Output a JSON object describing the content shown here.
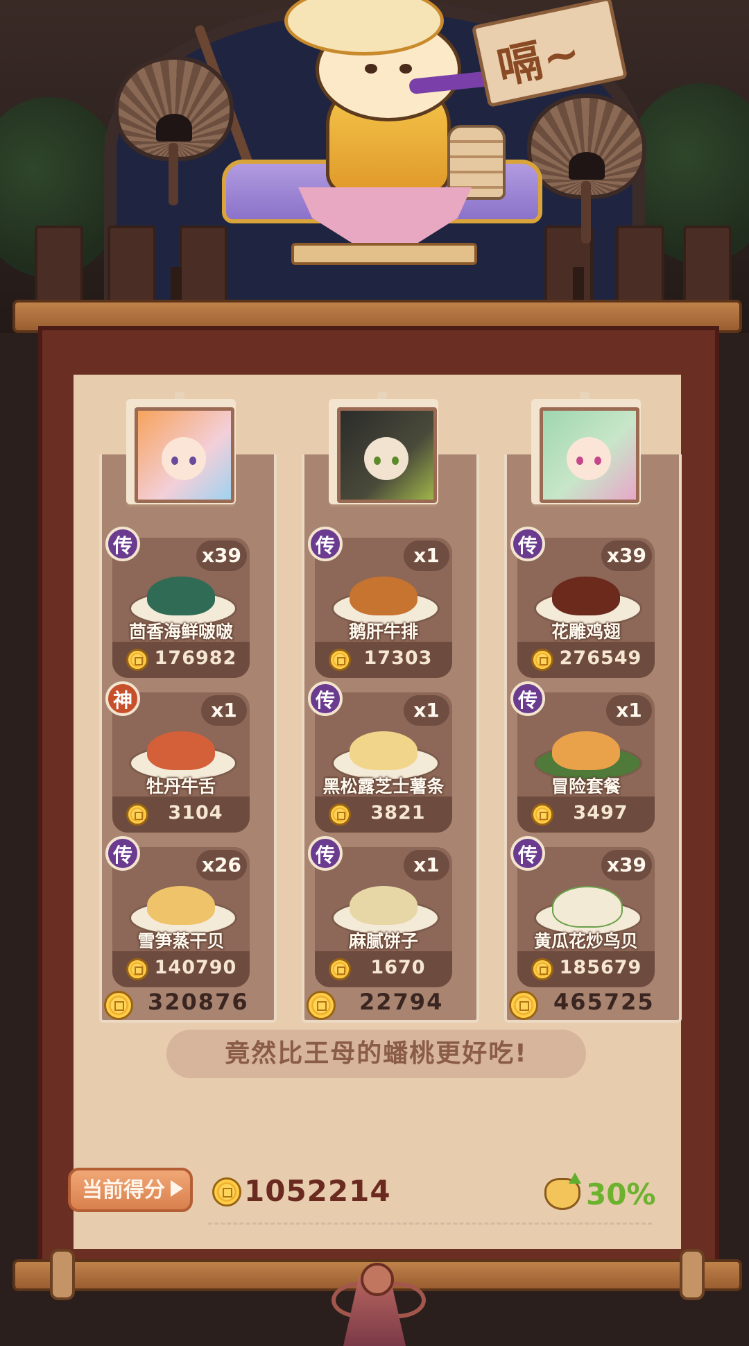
{
  "scene": {
    "sign_text": "嗝~"
  },
  "columns": [
    {
      "portrait": "character-pink-hair-icon",
      "total": "320876",
      "dishes": [
        {
          "badge": "传",
          "qty": "x39",
          "name": "茴香海鲜啵啵",
          "value": "176982",
          "food_color": "#2f6b55"
        },
        {
          "badge": "神",
          "qty": "x1",
          "name": "牡丹牛舌",
          "value": "3104",
          "food_color": "#d4603a"
        },
        {
          "badge": "传",
          "qty": "x26",
          "name": "雪笋蒸干贝",
          "value": "140790",
          "food_color": "#eec36a"
        }
      ]
    },
    {
      "portrait": "character-cat-witch-icon",
      "total": "22794",
      "dishes": [
        {
          "badge": "传",
          "qty": "x1",
          "name": "鹅肝牛排",
          "value": "17303",
          "food_color": "#c6742f"
        },
        {
          "badge": "传",
          "qty": "x1",
          "name": "黑松露芝士薯条",
          "value": "3821",
          "food_color": "#f1d58a"
        },
        {
          "badge": "传",
          "qty": "x1",
          "name": "麻腻饼子",
          "value": "1670",
          "food_color": "#e8d7a6"
        }
      ]
    },
    {
      "portrait": "character-green-hair-icon",
      "total": "465725",
      "dishes": [
        {
          "badge": "传",
          "qty": "x39",
          "name": "花雕鸡翅",
          "value": "276549",
          "food_color": "#6b2a1c"
        },
        {
          "badge": "传",
          "qty": "x1",
          "name": "冒险套餐",
          "value": "3497",
          "food_color": "#e9a14a"
        },
        {
          "badge": "传",
          "qty": "x39",
          "name": "黄瓜花炒鸟贝",
          "value": "185679",
          "food_color": "#f2ead4"
        }
      ]
    }
  ],
  "quote": "竟然比王母的蟠桃更好吃!",
  "score": {
    "label": "当前得分",
    "value": "1052214",
    "bonus_percent": "30%"
  },
  "colors": {
    "legend_badge": "#6a3b8f",
    "god_badge": "#c7502c",
    "bonus_green": "#6cb22e"
  }
}
